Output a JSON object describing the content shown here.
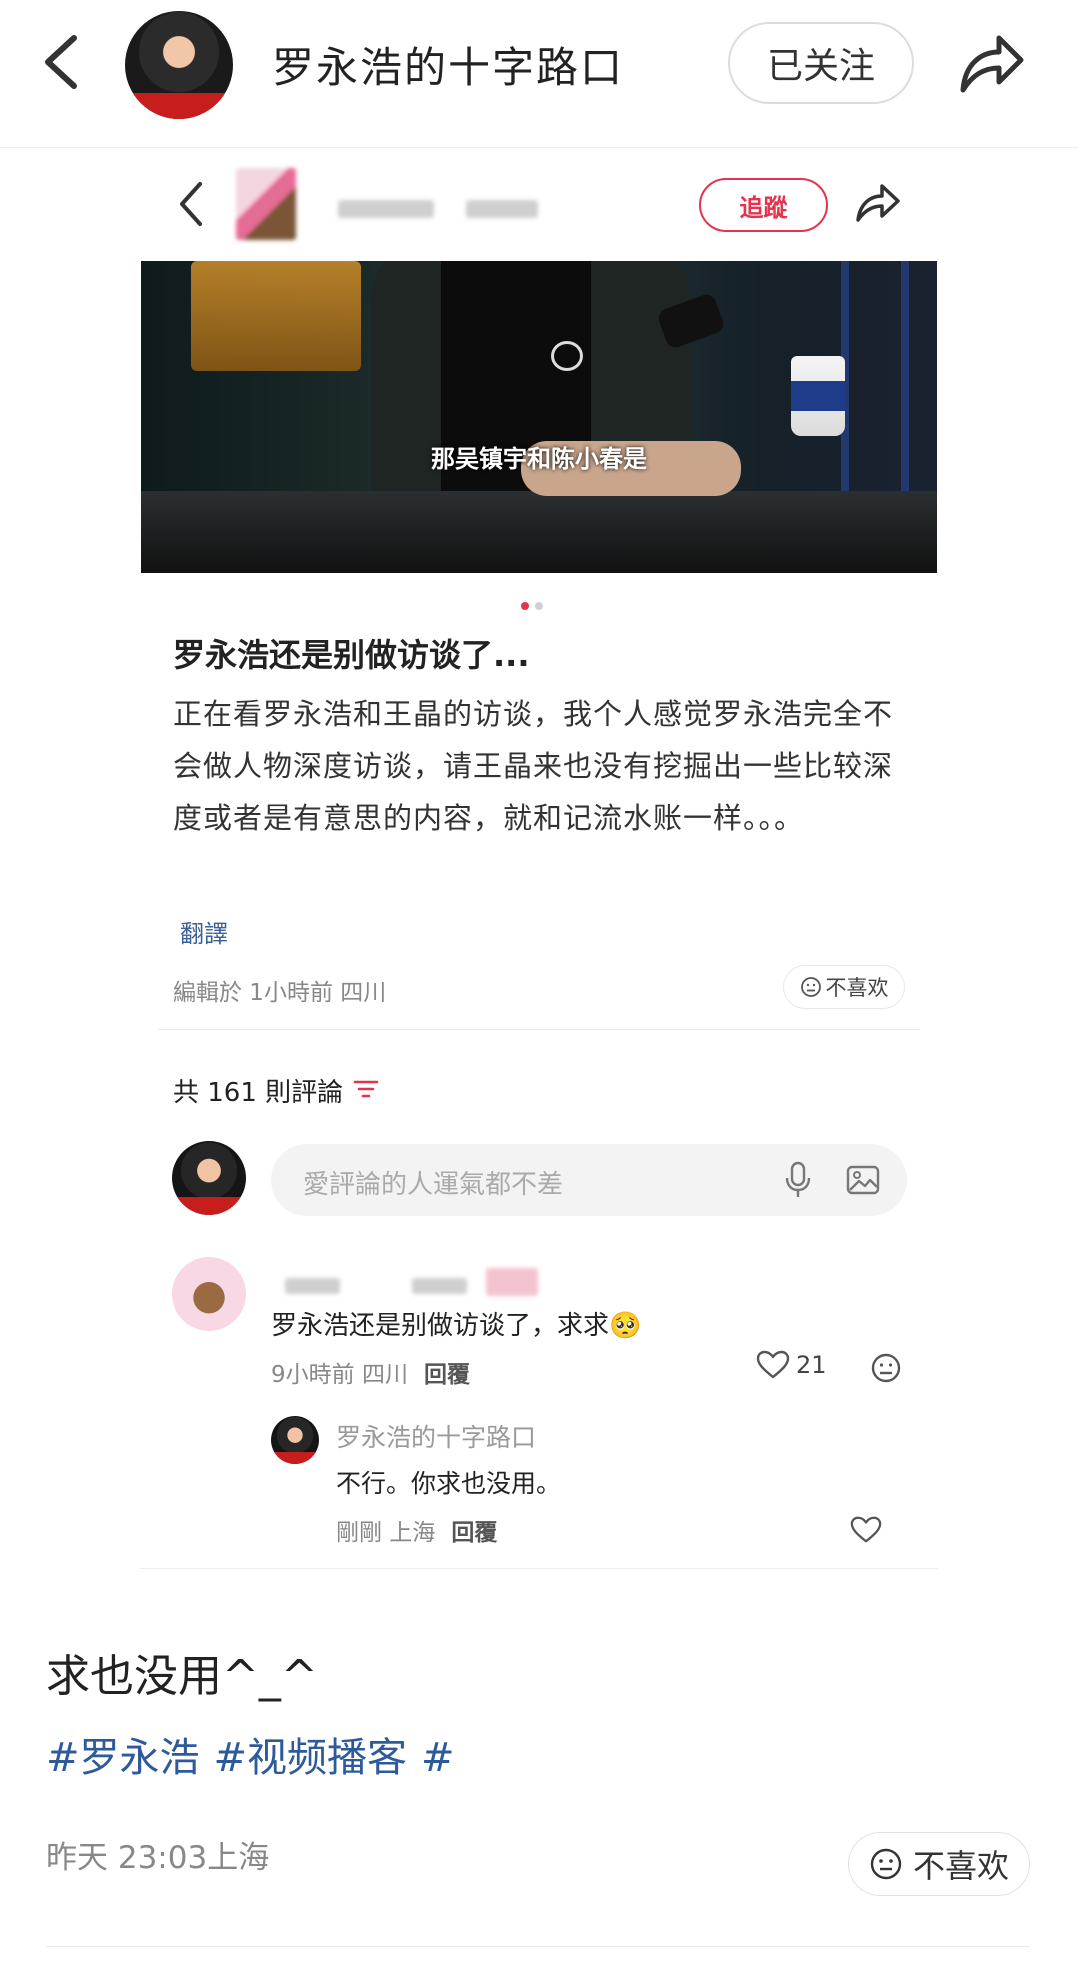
{
  "header": {
    "title": "罗永浩的十字路口",
    "follow_label": "已关注"
  },
  "embedded": {
    "follow_label": "追蹤",
    "video_subtitle": "那吴镇宇和陈小春是",
    "post_title": "罗永浩还是别做访谈了...",
    "post_body": "正在看罗永浩和王晶的访谈，我个人感觉罗永浩完全不会做人物深度访谈，请王晶来也没有挖掘出一些比较深度或者是有意思的内容，就和记流水账一样。。。",
    "translate_label": "翻譯",
    "meta": "編輯於 1小時前 四川",
    "dislike_label": "不喜欢",
    "comment_count": "共 161 則評論",
    "comment_placeholder": "愛評論的人運氣都不差",
    "comment": {
      "text": "罗永浩还是别做访谈了，求求🥺",
      "time": "9小時前 四川",
      "reply_label": "回覆",
      "likes": "21"
    },
    "reply": {
      "name": "罗永浩的十字路口",
      "text": "不行。你求也没用。",
      "time": "剛剛 上海",
      "reply_label": "回覆"
    }
  },
  "caption": {
    "text": "求也没用^_^",
    "tags": [
      "#罗永浩",
      "#视频播客",
      "#"
    ],
    "time": "昨天 23:03上海",
    "dislike_label": "不喜欢"
  },
  "colors": {
    "accent_red": "#e5334e",
    "link_blue": "#2d5a9a"
  }
}
